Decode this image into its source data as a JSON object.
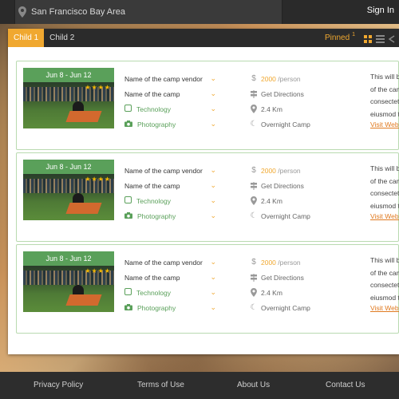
{
  "topbar": {
    "location": "San Francisco Bay Area",
    "signin": "Sign In"
  },
  "tabs": [
    {
      "label": "Child 1",
      "active": true
    },
    {
      "label": "Child 2",
      "active": false
    }
  ],
  "pinned": {
    "label": "Pinned",
    "count": "1"
  },
  "cards": [
    {
      "date": "Jun 8 - Jun 12",
      "rating": 4,
      "vendor": "Name of the camp vendor",
      "camp": "Name of the camp",
      "category": "Technology",
      "activity": "Photography",
      "price": "2000",
      "price_unit": "/person",
      "directions": "Get Directions",
      "distance": "2.4 Km",
      "type": "Overnight Camp",
      "desc": [
        "This will be",
        "of the camp",
        "consectetur",
        "eiusmod te"
      ],
      "visit": "Visit Website"
    },
    {
      "date": "Jun 8 - Jun 12",
      "rating": 4,
      "vendor": "Name of the camp vendor",
      "camp": "Name of the camp",
      "category": "Technology",
      "activity": "Photography",
      "price": "2000",
      "price_unit": "/person",
      "directions": "Get Directions",
      "distance": "2.4 Km",
      "type": "Overnight Camp",
      "desc": [
        "This will be",
        "of the camp",
        "consectetur",
        "eiusmod te"
      ],
      "visit": "Visit Website"
    },
    {
      "date": "Jun 8 - Jun 12",
      "rating": 4,
      "vendor": "Name of the camp vendor",
      "camp": "Name of the camp",
      "category": "Technology",
      "activity": "Photography",
      "price": "2000",
      "price_unit": "/person",
      "directions": "Get Directions",
      "distance": "2.4 Km",
      "type": "Overnight Camp",
      "desc": [
        "This will be",
        "of the camp",
        "consectetur",
        "eiusmod te"
      ],
      "visit": "Visit Website"
    }
  ],
  "footer": {
    "links": [
      "Privacy Policy",
      "Terms of Use",
      "About Us",
      "Contact Us"
    ]
  },
  "colors": {
    "accent": "#f0a830",
    "green": "#5aa05a",
    "border_green": "#b9dab0",
    "dark": "#2b2b2b"
  },
  "icons": {
    "location": "map-pin-icon",
    "grid_view": "grid-view-icon",
    "list_view": "list-view-icon",
    "price": "dollar-icon",
    "directions": "signpost-icon",
    "distance": "map-pin-icon",
    "camp_type": "moon-icon",
    "category": "square-icon",
    "activity": "camera-icon"
  }
}
